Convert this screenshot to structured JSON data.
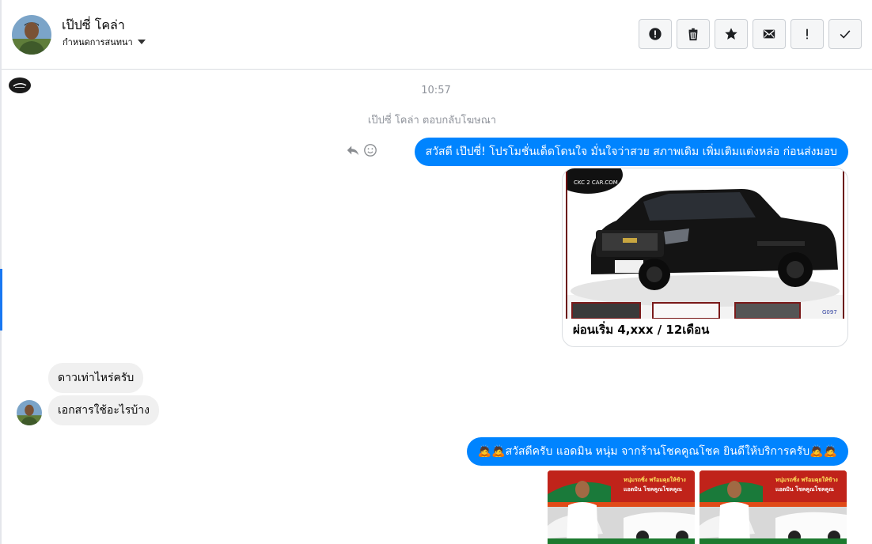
{
  "header": {
    "contact_name": "เป๊ปซี่ โคล่า",
    "subtitle": "กำหนดการสนทนา",
    "actions": [
      {
        "name": "report",
        "icon": "alert-circle-icon"
      },
      {
        "name": "delete",
        "icon": "trash-icon"
      },
      {
        "name": "star",
        "icon": "star-icon"
      },
      {
        "name": "mark-unread",
        "icon": "envelope-icon"
      },
      {
        "name": "important",
        "icon": "exclamation-icon"
      },
      {
        "name": "done",
        "icon": "check-icon"
      }
    ]
  },
  "thread": {
    "timestamp": "10:57",
    "system_note": "เป๊ปซี่ โคล่า ตอบกลับโฆษณา",
    "msg1": "สวัสดี เป๊ปซี่! โปรโมชั่นเด็ดโดนใจ มั่นใจว่าสวย สภาพเดิม เพิ่มเติมแต่งหล่อ ก่อนส่งมอบ",
    "card": {
      "logo_text": "CKC 2 CAR.COM",
      "code": "G097",
      "caption": "ผ่อนเริ่ม 4,xxx / 12เดือน"
    },
    "msg_in_1": "ดาวเท่าไหร่ครับ",
    "msg_in_2": "เอกสารใช้อะไรบ้าง",
    "msg2": "🙇🙇สวัสดีครับ แอดมิน หนุ่ม จากร้านโชคคูณโชค ยินดีให้บริการครับ🙇🙇",
    "promo": {
      "headline_1": "หนุ่มรถซิ่ง พร้อมคุยให้ข้าง",
      "headline_2": "แอดมิน โชคคูณโชคคูณ"
    }
  },
  "colors": {
    "accent": "#0084ff",
    "incoming_bubble": "#f0f0f0",
    "meta_text": "#90949c"
  }
}
